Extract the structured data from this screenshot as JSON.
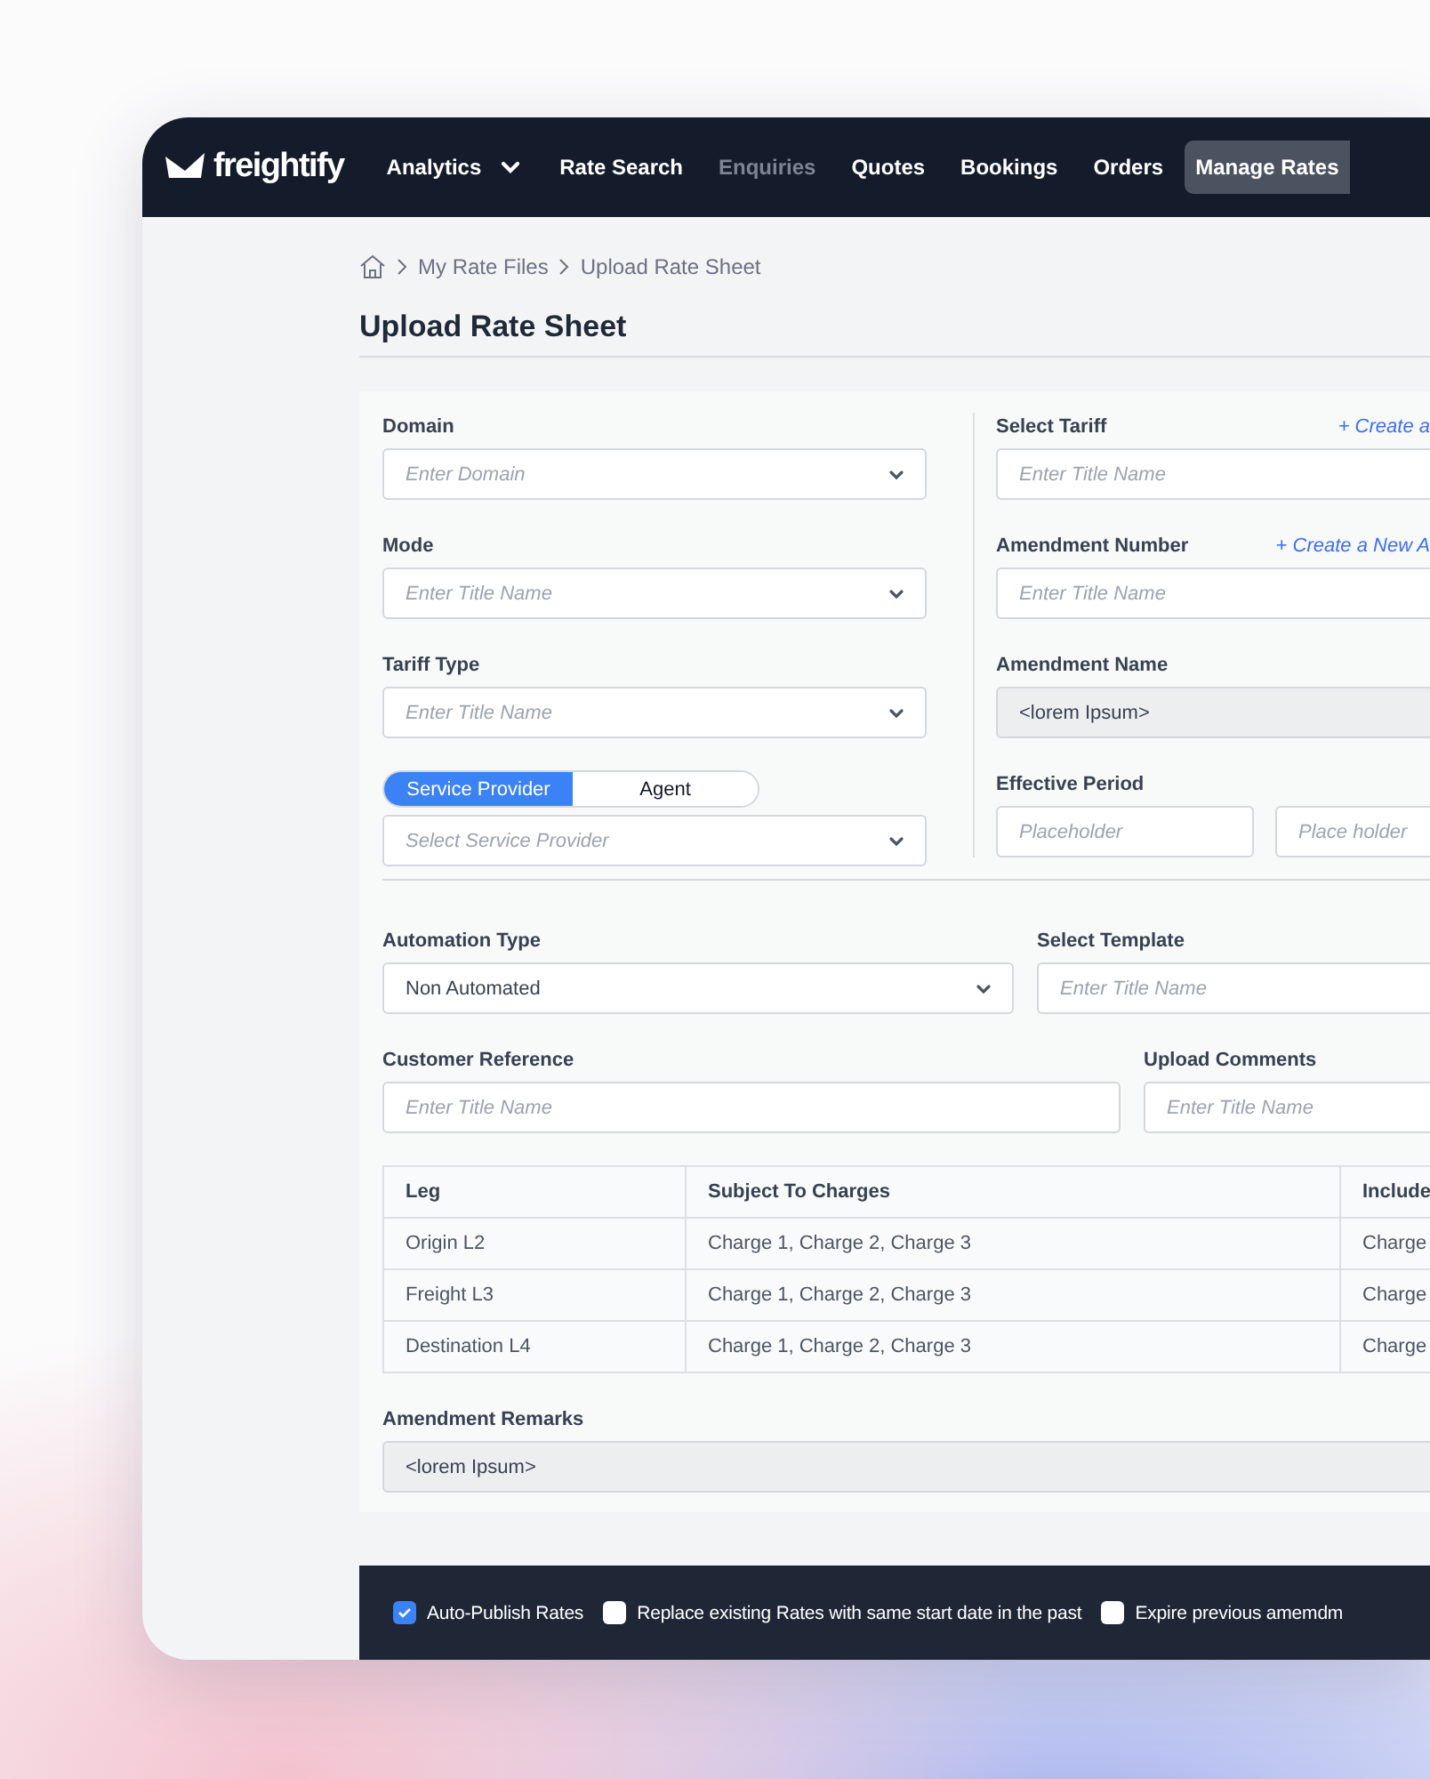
{
  "nav": {
    "logo": "freightify",
    "items": [
      {
        "label": "Analytics",
        "dropdown": true,
        "selected": false,
        "disabled": false
      },
      {
        "label": "Rate Search",
        "dropdown": false,
        "selected": false,
        "disabled": false
      },
      {
        "label": "Enquiries",
        "dropdown": false,
        "selected": false,
        "disabled": true
      },
      {
        "label": "Quotes",
        "dropdown": false,
        "selected": false,
        "disabled": false
      },
      {
        "label": "Bookings",
        "dropdown": false,
        "selected": false,
        "disabled": false
      },
      {
        "label": "Orders",
        "dropdown": false,
        "selected": false,
        "disabled": false
      },
      {
        "label": "Manage Rates",
        "dropdown": false,
        "selected": true,
        "disabled": false
      }
    ]
  },
  "breadcrumb": [
    "My Rate Files",
    "Upload Rate Sheet"
  ],
  "title": "Upload Rate Sheet",
  "left_fields": [
    {
      "kind": "select",
      "label": "Domain",
      "placeholder": "Enter Domain"
    },
    {
      "kind": "select",
      "label": "Mode",
      "placeholder": "Enter Title Name"
    },
    {
      "kind": "select",
      "label": "Tariff Type",
      "placeholder": "Enter Title Name"
    },
    {
      "kind": "toggle-select",
      "options": [
        {
          "label": "Service Provider",
          "selected": true
        },
        {
          "label": "Agent",
          "selected": false
        }
      ],
      "placeholder": "Select Service Provider"
    }
  ],
  "right_fields": [
    {
      "kind": "input",
      "label": "Select Tariff",
      "link": "+ Create a",
      "placeholder": "Enter Title Name"
    },
    {
      "kind": "input",
      "label": "Amendment Number",
      "link": "+ Create a New A",
      "placeholder": "Enter Title Name"
    },
    {
      "kind": "readonly",
      "label": "Amendment Name",
      "value": "<lorem Ipsum>"
    },
    {
      "kind": "range",
      "label": "Effective Period",
      "placeholders": [
        "Placeholder",
        "Place holder"
      ]
    }
  ],
  "automation_type": {
    "label": "Automation Type",
    "value": "Non Automated"
  },
  "select_template": {
    "label": "Select Template",
    "placeholder": "Enter Title Name"
  },
  "customer_reference": {
    "label": "Customer Reference",
    "placeholder": "Enter Title Name"
  },
  "upload_comments": {
    "label": "Upload Comments",
    "placeholder": "Enter Title Name"
  },
  "table": {
    "columns": [
      "Leg",
      "Subject To Charges",
      "Include"
    ],
    "rows": [
      [
        "Origin L2",
        "Charge 1, Charge 2, Charge 3",
        "Charge"
      ],
      [
        "Freight L3",
        "Charge 1, Charge 2, Charge 3",
        "Charge"
      ],
      [
        "Destination L4",
        "Charge 1, Charge 2, Charge 3",
        "Charge"
      ]
    ]
  },
  "amendment_remarks": {
    "label": "Amendment Remarks",
    "value": "<lorem Ipsum>"
  },
  "footer_options": [
    {
      "label": "Auto-Publish Rates",
      "checked": true
    },
    {
      "label": "Replace existing Rates with same start date in the past",
      "checked": false
    },
    {
      "label": "Expire previous amemdm",
      "checked": false
    }
  ]
}
